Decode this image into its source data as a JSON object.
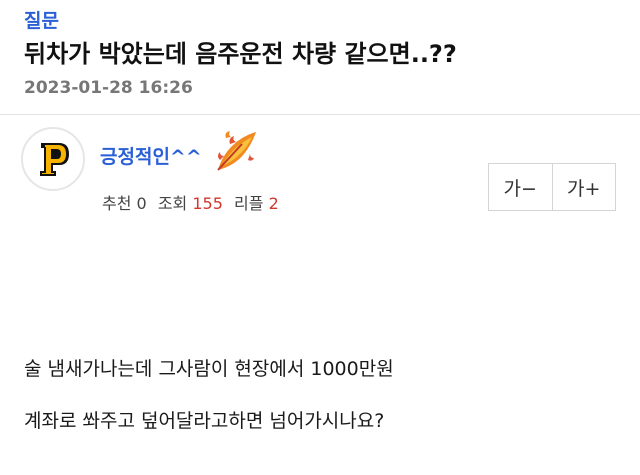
{
  "post": {
    "category": "질문",
    "title": "뒤차가 박았는데 음주운전 차량 같으면..??",
    "date": "2023-01-28 16:26"
  },
  "author": {
    "nickname": "긍정적인^^",
    "avatar_icon": "pirates-p-logo-icon",
    "badge_icon": "flaming-feather-icon"
  },
  "stats": {
    "recommend_label": "추천",
    "recommend_count": "0",
    "views_label": "조회",
    "views_count": "155",
    "replies_label": "리플",
    "replies_count": "2",
    "highlight_color": "#d0372f"
  },
  "font_controls": {
    "decrease_label": "가−",
    "increase_label": "가+"
  },
  "content": {
    "line1": "술 냄새가나는데 그사람이 현장에서 1000만원",
    "line2": "계좌로 쏴주고 덮어달라고하면 넘어가시나요?"
  },
  "colors": {
    "accent": "#2a5fd6",
    "muted": "#777777"
  }
}
